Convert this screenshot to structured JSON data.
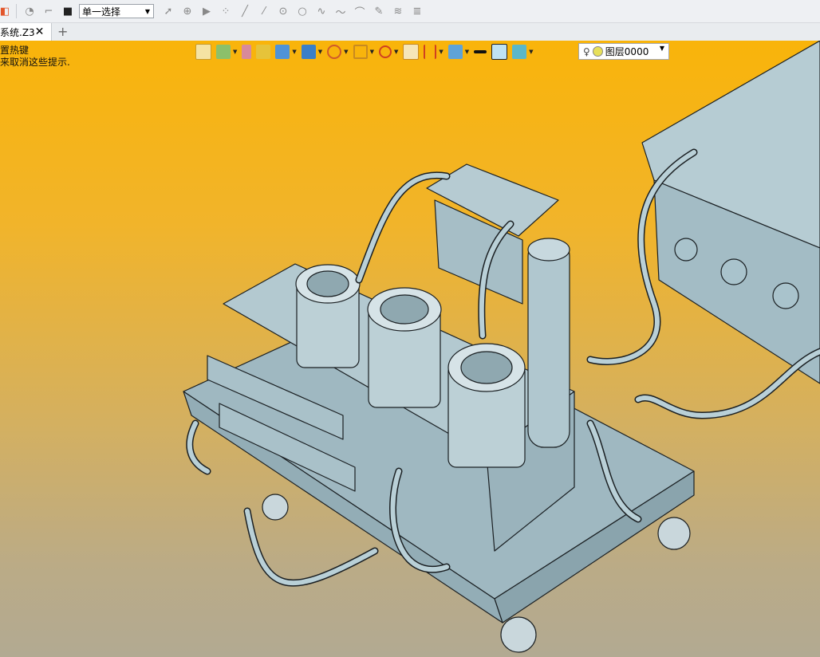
{
  "toolbar": {
    "selection_mode": "单一选择",
    "icons": [
      "app-logo-icon",
      "timer-icon",
      "filter-icon",
      "stop-icon",
      "pick-arrow-icon",
      "pick-point-icon",
      "play-icon",
      "dots-icon",
      "line-icon",
      "slash-icon",
      "circle-center-icon",
      "circle-icon",
      "spline-icon",
      "wave-icon",
      "arc-icon",
      "pen-icon",
      "layer-stack-icon",
      "layers-icon"
    ]
  },
  "tab": {
    "label": "系统.Z3",
    "close": "✕",
    "add": "+"
  },
  "viewport": {
    "hint_line1": "置热键",
    "hint_line2": "来取消这些提示.",
    "background_colors": [
      "#f9b40a",
      "#b2aa92"
    ]
  },
  "viewbar": {
    "layer_label": "图层0000"
  },
  "colors": {
    "model_fill": "#a9c3cc",
    "model_edge": "#1a1f22"
  }
}
